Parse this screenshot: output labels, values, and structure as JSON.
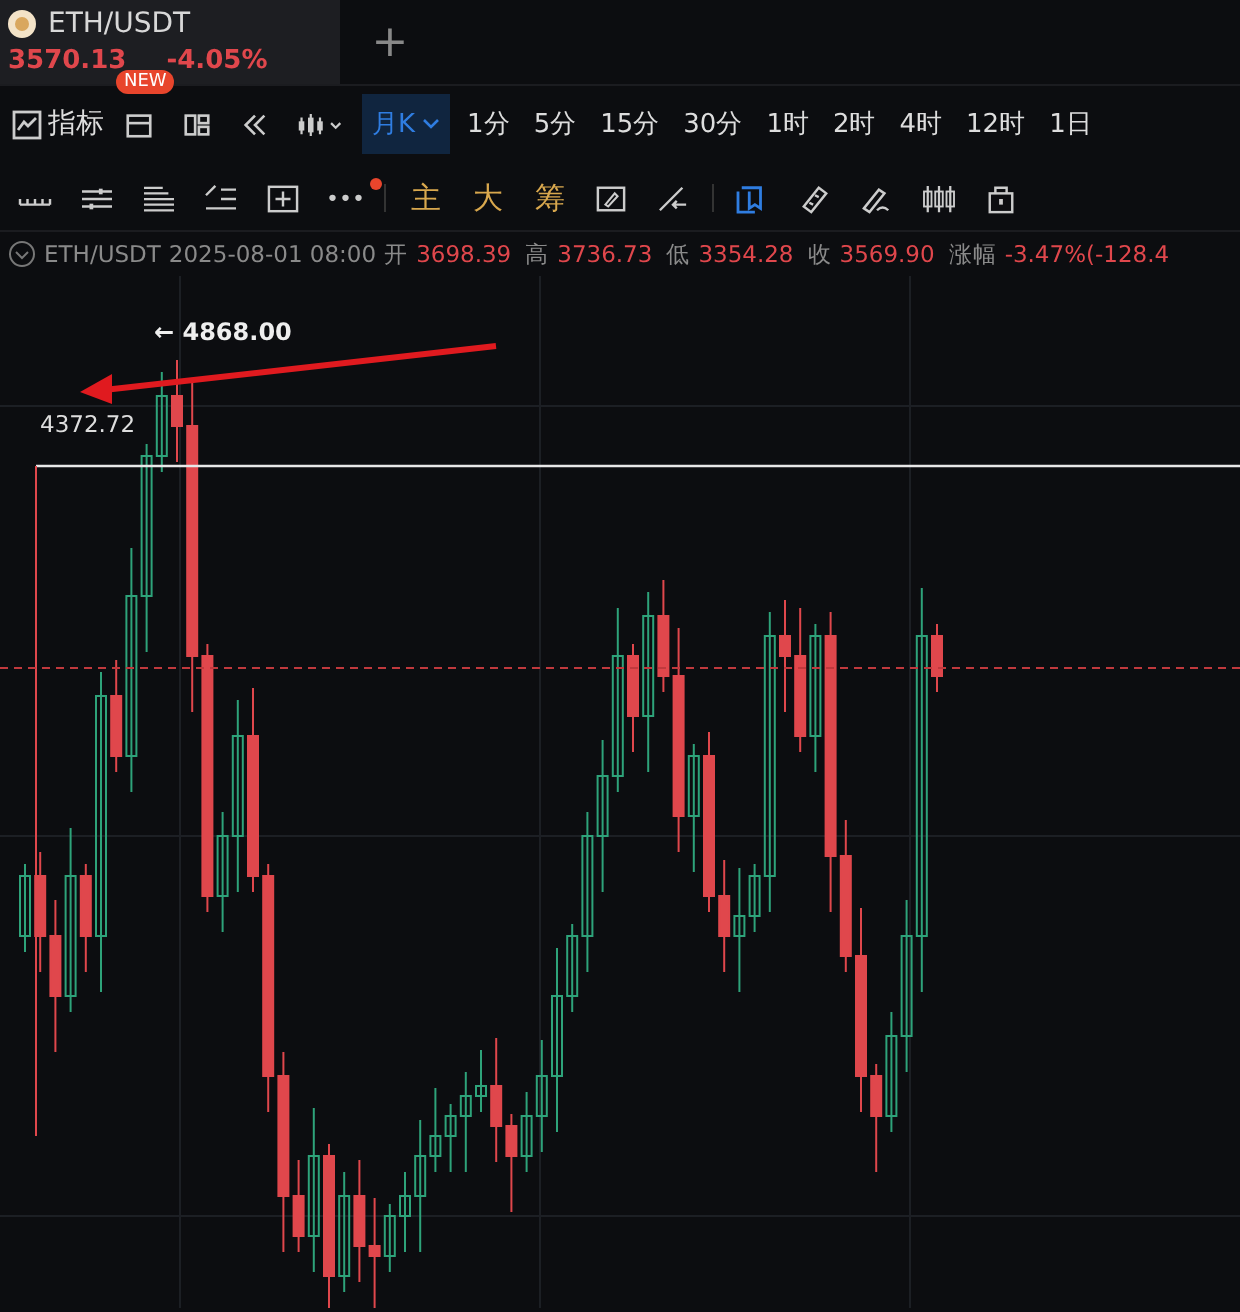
{
  "tab": {
    "symbol": "ETH/USDT",
    "price": "3570.13",
    "change": "-4.05%",
    "badge": "NEW",
    "add": "+"
  },
  "toolbar": {
    "indicator": "指标",
    "period": {
      "label": "月K",
      "selected": true
    },
    "intervals": [
      {
        "label": "1分",
        "selected": false
      },
      {
        "label": "5分",
        "selected": false
      },
      {
        "label": "15分",
        "selected": false
      },
      {
        "label": "30分",
        "selected": false
      },
      {
        "label": "1时",
        "selected": false
      },
      {
        "label": "2时",
        "selected": false
      },
      {
        "label": "4时",
        "selected": false
      },
      {
        "label": "12时",
        "selected": false
      },
      {
        "label": "1日",
        "selected": false
      }
    ]
  },
  "tools": {
    "more": "•••",
    "more_dot": true,
    "text_tools": [
      "主",
      "大",
      "筹"
    ],
    "cursor_active": true
  },
  "info": {
    "symbol": "ETH/USDT",
    "time": "2025-08-01 08:00",
    "fields": [
      {
        "label": "开",
        "value": "3698.39"
      },
      {
        "label": "高",
        "value": "3736.73"
      },
      {
        "label": "低",
        "value": "3354.28"
      },
      {
        "label": "收",
        "value": "3569.90"
      },
      {
        "label": "涨幅",
        "value": "-3.47%(-128.4"
      }
    ]
  },
  "chart": {
    "high_label": "← 4868.00",
    "level_label": "4372.72"
  }
}
